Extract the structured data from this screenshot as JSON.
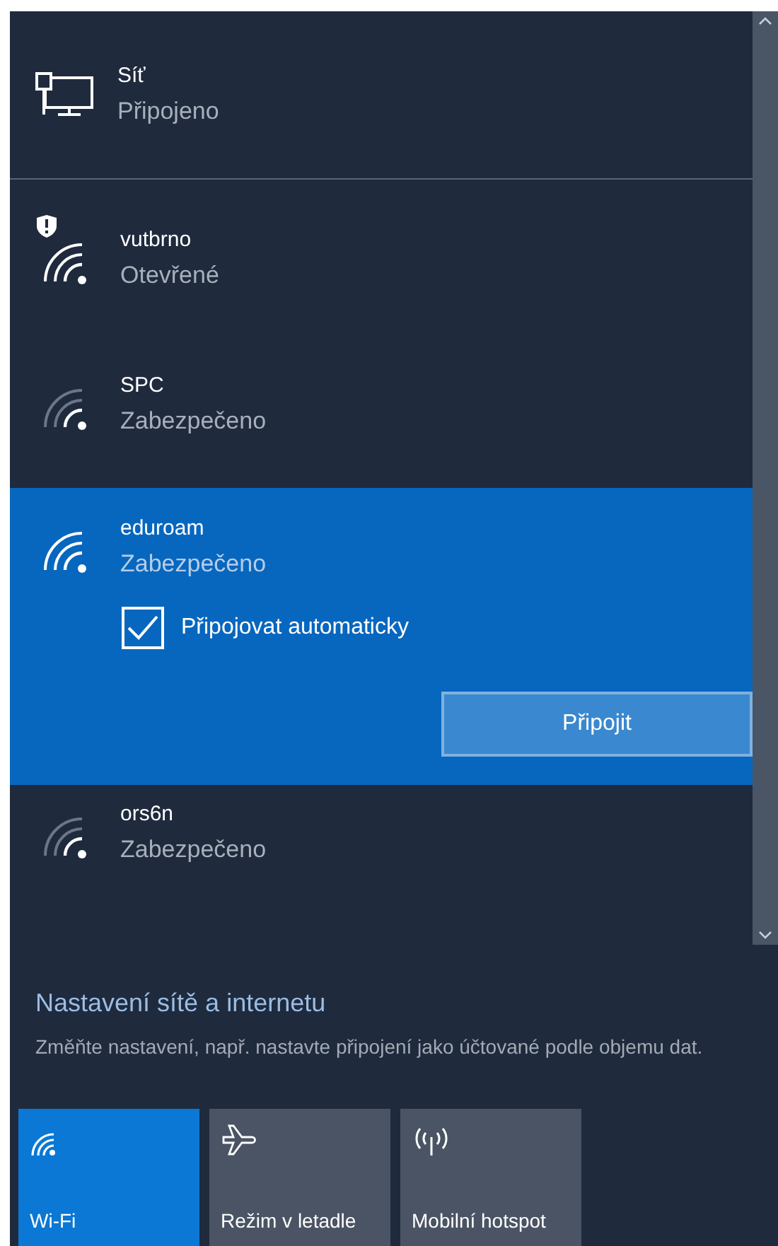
{
  "wired": {
    "name": "Síť",
    "status": "Připojeno"
  },
  "networks": [
    {
      "name": "vutbrno",
      "status": "Otevřené",
      "open_warning": true,
      "selected": false
    },
    {
      "name": "SPC",
      "status": "Zabezpečeno",
      "open_warning": false,
      "selected": false
    },
    {
      "name": "eduroam",
      "status": "Zabezpečeno",
      "open_warning": false,
      "selected": true,
      "auto_connect": {
        "label": "Připojovat automaticky",
        "checked": true
      },
      "button": "Připojit"
    },
    {
      "name": "ors6n",
      "status": "Zabezpečeno",
      "open_warning": false,
      "selected": false
    }
  ],
  "settings": {
    "link": "Nastavení sítě a internetu",
    "description": "Změňte nastavení, např. nastavte připojení jako účtované podle objemu dat."
  },
  "tiles": [
    {
      "kind": "wifi",
      "label": "Wi-Fi",
      "on": true
    },
    {
      "kind": "airplane",
      "label": "Režim v letadle",
      "on": false
    },
    {
      "kind": "hotspot",
      "label": "Mobilní hotspot",
      "on": false
    }
  ]
}
